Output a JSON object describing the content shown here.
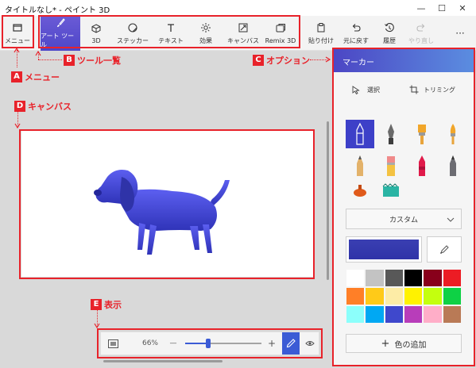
{
  "window": {
    "title": "タイトルなし* - ペイント 3D",
    "minimize_glyph": "—",
    "maximize_glyph": "☐",
    "close_glyph": "✕"
  },
  "toolbar": {
    "menu_label": "メニュー",
    "tools": [
      {
        "label": "アート ツール",
        "icon": "brush-icon",
        "active": true
      },
      {
        "label": "3D",
        "icon": "cube-icon"
      },
      {
        "label": "ステッカー",
        "icon": "sticker-icon"
      },
      {
        "label": "テキスト",
        "icon": "text-icon"
      },
      {
        "label": "効果",
        "icon": "effects-icon"
      },
      {
        "label": "キャンバス",
        "icon": "canvas-icon"
      },
      {
        "label": "Remix 3D",
        "icon": "remix-icon"
      }
    ],
    "actions": [
      {
        "label": "貼り付け",
        "icon": "paste-icon"
      },
      {
        "label": "元に戻す",
        "icon": "undo-icon"
      },
      {
        "label": "履歴",
        "icon": "history-icon"
      },
      {
        "label": "やり直し",
        "icon": "redo-icon",
        "disabled": true
      }
    ],
    "more_glyph": "···"
  },
  "callouts": {
    "a": {
      "letter": "A",
      "text": "メニュー"
    },
    "b": {
      "letter": "B",
      "text": "ツール一覧"
    },
    "c": {
      "letter": "C",
      "text": "オプション"
    },
    "d": {
      "letter": "D",
      "text": "キャンバス"
    },
    "e": {
      "letter": "E",
      "text": "表示"
    }
  },
  "panel": {
    "title": "マーカー",
    "select_label": "選択",
    "trim_label": "トリミング",
    "brush_icons": [
      "marker-icon",
      "calligraphy-pen-icon",
      "oil-brush-icon",
      "watercolor-icon",
      "pixel-pen-icon",
      "pencil-icon",
      "eraser-icon",
      "crayon-icon",
      "spray-can-icon",
      "fill-bucket-icon"
    ],
    "thickness_label": "カスタム",
    "current_color": "#3538b0",
    "add_color_label": "色の追加",
    "palette": [
      "#ffffff",
      "#c3c3c3",
      "#585858",
      "#000000",
      "#88001b",
      "#ec1c24",
      "#ff7f27",
      "#ffca18",
      "#fdeca6",
      "#fff200",
      "#c4ff0e",
      "#0ed145",
      "#8cfffb",
      "#00a8f3",
      "#3f48cc",
      "#b83dba",
      "#ffaec8",
      "#b97a56"
    ]
  },
  "viewbar": {
    "zoom": "66%",
    "minus_glyph": "—",
    "plus_glyph": "+",
    "zoom_level": 0.3
  },
  "colors": {
    "accent": "#4d46c8",
    "callout_red": "#e8222a",
    "dog_blue": "#3d40d0"
  }
}
